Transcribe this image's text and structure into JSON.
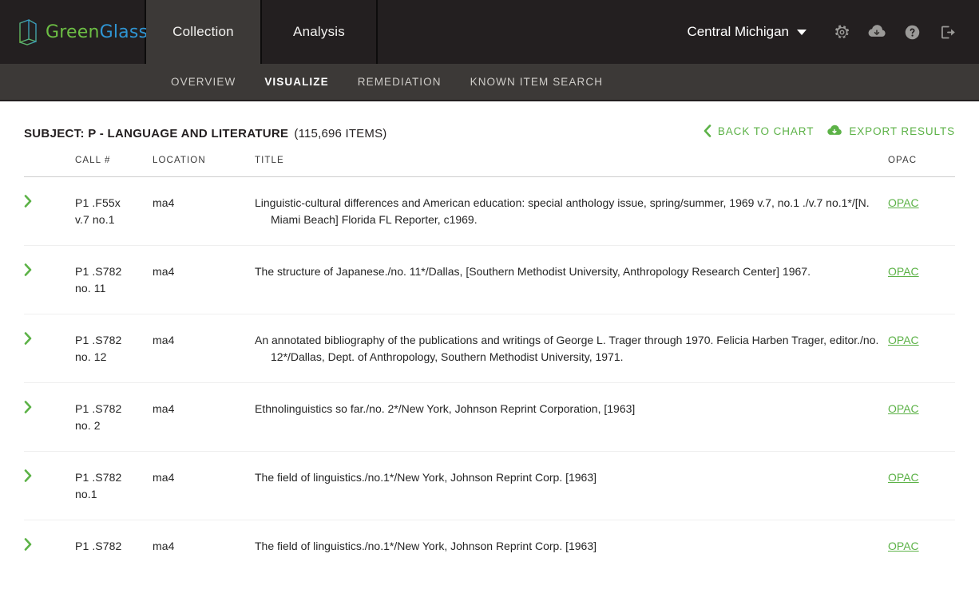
{
  "brand": {
    "name_part1": "Green",
    "name_part2": "Glass",
    "logo_icon": "greenglass-book-logo-icon",
    "color_green": "#6cbe44",
    "color_blue": "#2f95d3"
  },
  "header": {
    "tabs": [
      {
        "label": "Collection",
        "active": true
      },
      {
        "label": "Analysis",
        "active": false
      }
    ],
    "organization": "Central Michigan",
    "caret_icon": "chevron-down-icon",
    "icons": [
      {
        "name": "gear-icon",
        "title": "Settings"
      },
      {
        "name": "cloud-download-icon",
        "title": "Downloads"
      },
      {
        "name": "help-circle-icon",
        "title": "Help"
      },
      {
        "name": "logout-icon",
        "title": "Sign out"
      }
    ]
  },
  "subnav": {
    "items": [
      {
        "label": "OVERVIEW",
        "active": false
      },
      {
        "label": "VISUALIZE",
        "active": true
      },
      {
        "label": "REMEDIATION",
        "active": false
      },
      {
        "label": "KNOWN ITEM SEARCH",
        "active": false
      }
    ]
  },
  "page": {
    "title": "SUBJECT: P - LANGUAGE AND LITERATURE",
    "count": "(115,696 ITEMS)",
    "actions": [
      {
        "label": "BACK TO CHART",
        "icon": "chevron-left-icon"
      },
      {
        "label": "EXPORT RESULTS",
        "icon": "cloud-download-icon"
      }
    ],
    "accent_green": "#5cb247"
  },
  "table": {
    "columns": [
      "",
      "CALL #",
      "LOCATION",
      "TITLE",
      "OPAC"
    ],
    "headers": {
      "call": "CALL #",
      "location": "LOCATION",
      "title": "TITLE",
      "opac": "OPAC"
    },
    "expand_icon": "chevron-right-icon",
    "rows": [
      {
        "call": "P1 .F55x\nv.7 no.1",
        "location": "ma4",
        "title": "Linguistic-cultural differences and American education: special anthology issue, spring/summer, 1969 v.7, no.1 ./v.7 no.1*/[N. Miami Beach] Florida FL Reporter, c1969.",
        "opac": "OPAC"
      },
      {
        "call": "P1 .S782\nno. 11",
        "location": "ma4",
        "title": "The structure of Japanese./no. 11*/Dallas, [Southern Methodist University, Anthropology Research Center] 1967.",
        "opac": "OPAC"
      },
      {
        "call": "P1 .S782\nno. 12",
        "location": "ma4",
        "title": "An annotated bibliography of the publications and writings of George L. Trager through 1970. Felicia Harben Trager, editor./no. 12*/Dallas, Dept. of Anthropology, Southern Methodist University, 1971.",
        "opac": "OPAC"
      },
      {
        "call": "P1 .S782\nno. 2",
        "location": "ma4",
        "title": "Ethnolinguistics so far./no. 2*/New York, Johnson Reprint Corporation, [1963]",
        "opac": "OPAC"
      },
      {
        "call": "P1 .S782\nno.1",
        "location": "ma4",
        "title": "The field of linguistics./no.1*/New York, Johnson Reprint Corp. [1963]",
        "opac": "OPAC"
      },
      {
        "call": "P1 .S782",
        "location": "ma4",
        "title": "The field of linguistics./no.1*/New York, Johnson Reprint Corp. [1963]",
        "opac": "OPAC"
      }
    ]
  }
}
